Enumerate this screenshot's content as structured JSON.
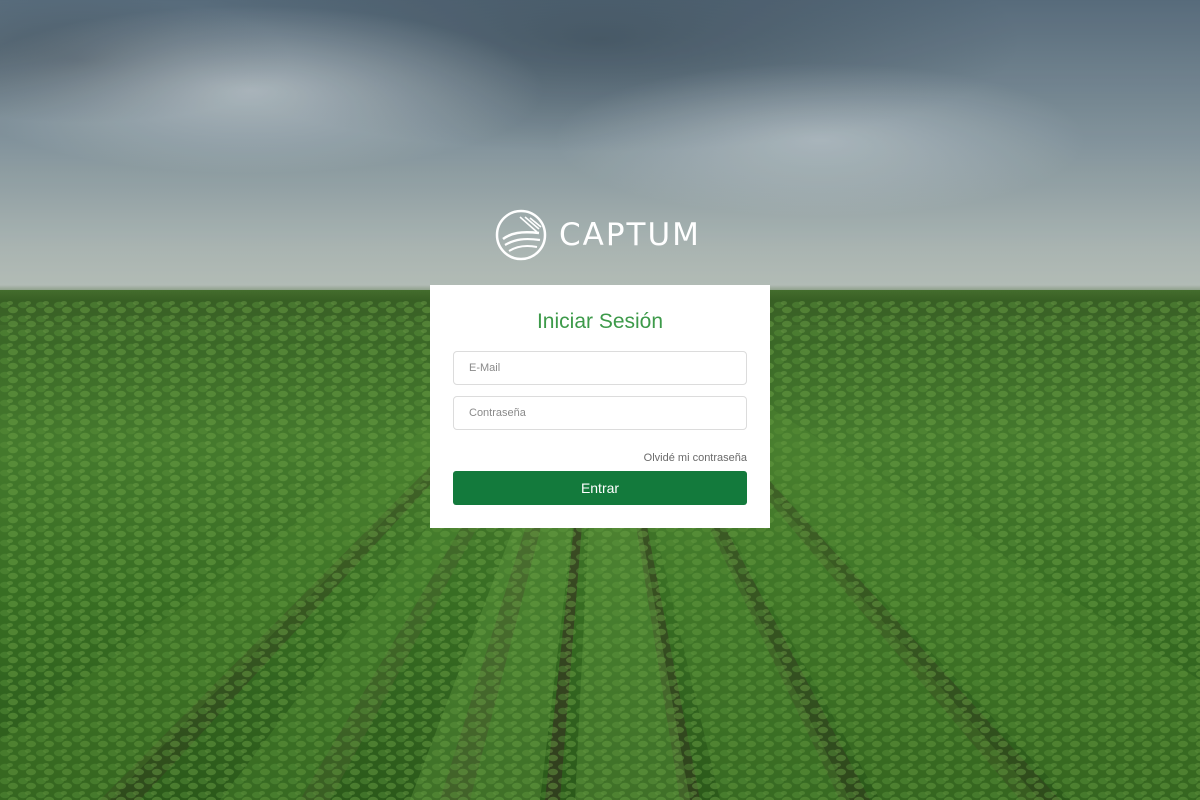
{
  "brand": {
    "name": "CAPTUM",
    "logo_icon": "field-globe-icon"
  },
  "login": {
    "title": "Iniciar Sesión",
    "email_placeholder": "E-Mail",
    "email_value": "",
    "password_placeholder": "Contraseña",
    "password_value": "",
    "forgot_label": "Olvidé mi contraseña",
    "submit_label": "Entrar"
  },
  "colors": {
    "accent_green": "#3d9a4a",
    "button_green": "#137a3c",
    "card_background": "#ffffff"
  }
}
